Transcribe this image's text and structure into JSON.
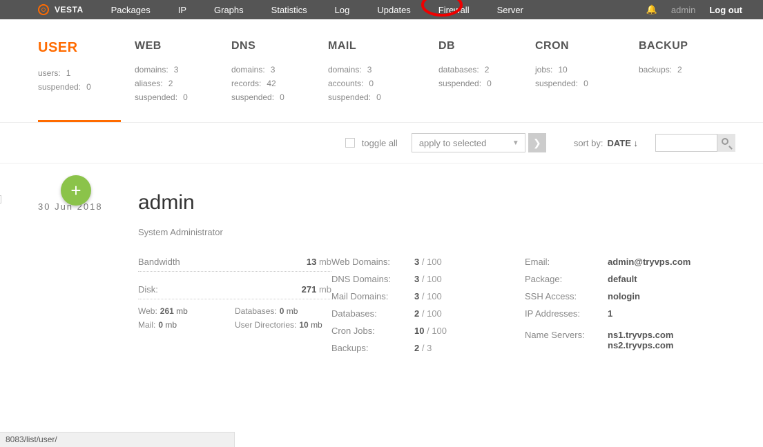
{
  "topbar": {
    "brand": "VESTA",
    "nav": [
      "Packages",
      "IP",
      "Graphs",
      "Statistics",
      "Log",
      "Updates",
      "Firewall",
      "Server"
    ],
    "user": "admin",
    "logout": "Log out"
  },
  "stats": {
    "user": {
      "title": "USER",
      "rows": [
        {
          "l": "users:",
          "v": "1"
        },
        {
          "l": "suspended:",
          "v": "0"
        }
      ]
    },
    "web": {
      "title": "WEB",
      "rows": [
        {
          "l": "domains:",
          "v": "3"
        },
        {
          "l": "aliases:",
          "v": "2"
        },
        {
          "l": "suspended:",
          "v": "0"
        }
      ]
    },
    "dns": {
      "title": "DNS",
      "rows": [
        {
          "l": "domains:",
          "v": "3"
        },
        {
          "l": "records:",
          "v": "42"
        },
        {
          "l": "suspended:",
          "v": "0"
        }
      ]
    },
    "mail": {
      "title": "MAIL",
      "rows": [
        {
          "l": "domains:",
          "v": "3"
        },
        {
          "l": "accounts:",
          "v": "0"
        },
        {
          "l": "suspended:",
          "v": "0"
        }
      ]
    },
    "db": {
      "title": "DB",
      "rows": [
        {
          "l": "databases:",
          "v": "2"
        },
        {
          "l": "suspended:",
          "v": "0"
        }
      ]
    },
    "cron": {
      "title": "CRON",
      "rows": [
        {
          "l": "jobs:",
          "v": "10"
        },
        {
          "l": "suspended:",
          "v": "0"
        }
      ]
    },
    "backup": {
      "title": "BACKUP",
      "rows": [
        {
          "l": "backups:",
          "v": "2"
        }
      ]
    }
  },
  "toolbar": {
    "toggle_all": "toggle all",
    "apply": "apply to selected",
    "sort_label": "sort by:",
    "sort_value": "DATE ↓"
  },
  "item": {
    "date": "30 Jun 2018",
    "name": "admin",
    "role": "System Administrator",
    "bandwidth": {
      "label": "Bandwidth",
      "value": "13",
      "unit": "mb"
    },
    "disk": {
      "label": "Disk:",
      "value": "271",
      "unit": "mb"
    },
    "disk_sub": [
      {
        "l": "Web:",
        "v": "261",
        "u": "mb"
      },
      {
        "l": "Mail:",
        "v": "0",
        "u": "mb"
      },
      {
        "l": "Databases:",
        "v": "0",
        "u": "mb"
      },
      {
        "l": "User Directories:",
        "v": "10",
        "u": "mb"
      }
    ],
    "limits": [
      {
        "l": "Web Domains:",
        "v": "3",
        "t": "100"
      },
      {
        "l": "DNS Domains:",
        "v": "3",
        "t": "100"
      },
      {
        "l": "Mail Domains:",
        "v": "3",
        "t": "100"
      },
      {
        "l": "Databases:",
        "v": "2",
        "t": "100"
      },
      {
        "l": "Cron Jobs:",
        "v": "10",
        "t": "100"
      },
      {
        "l": "Backups:",
        "v": "2",
        "t": "3"
      }
    ],
    "info": {
      "email_l": "Email:",
      "email_v": "admin@tryvps.com",
      "package_l": "Package:",
      "package_v": "default",
      "ssh_l": "SSH Access:",
      "ssh_v": "nologin",
      "ip_l": "IP Addresses:",
      "ip_v": "1",
      "ns_l": "Name Servers:",
      "ns_v1": "ns1.tryvps.com",
      "ns_v2": "ns2.tryvps.com"
    }
  },
  "status_bar": "8083/list/user/"
}
